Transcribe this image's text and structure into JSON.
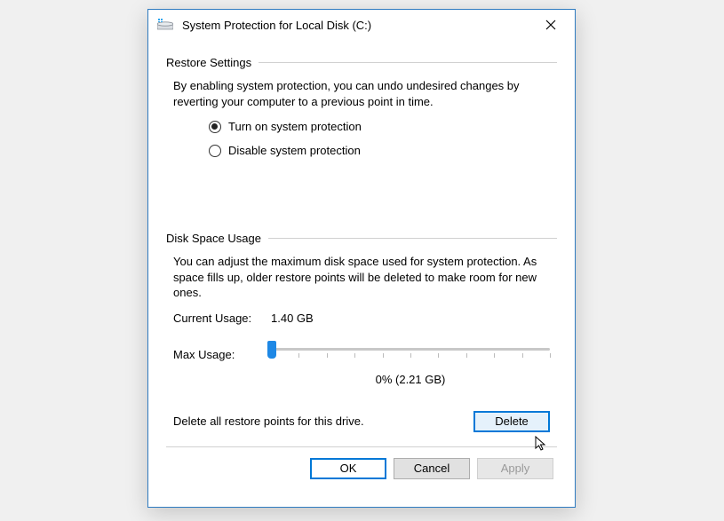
{
  "window": {
    "title": "System Protection for Local Disk (C:)"
  },
  "restore": {
    "heading": "Restore Settings",
    "description": "By enabling system protection, you can undo undesired changes by reverting your computer to a previous point in time.",
    "options": {
      "on": "Turn on system protection",
      "off": "Disable system protection"
    },
    "selected": "on"
  },
  "diskUsage": {
    "heading": "Disk Space Usage",
    "description": "You can adjust the maximum disk space used for system protection. As space fills up, older restore points will be deleted to make room for new ones.",
    "currentLabel": "Current Usage:",
    "currentValue": "1.40 GB",
    "maxLabel": "Max Usage:",
    "sliderValue": "0% (2.21 GB)",
    "sliderPercent": 0,
    "deleteText": "Delete all restore points for this drive.",
    "deleteButton": "Delete"
  },
  "footer": {
    "ok": "OK",
    "cancel": "Cancel",
    "apply": "Apply"
  }
}
